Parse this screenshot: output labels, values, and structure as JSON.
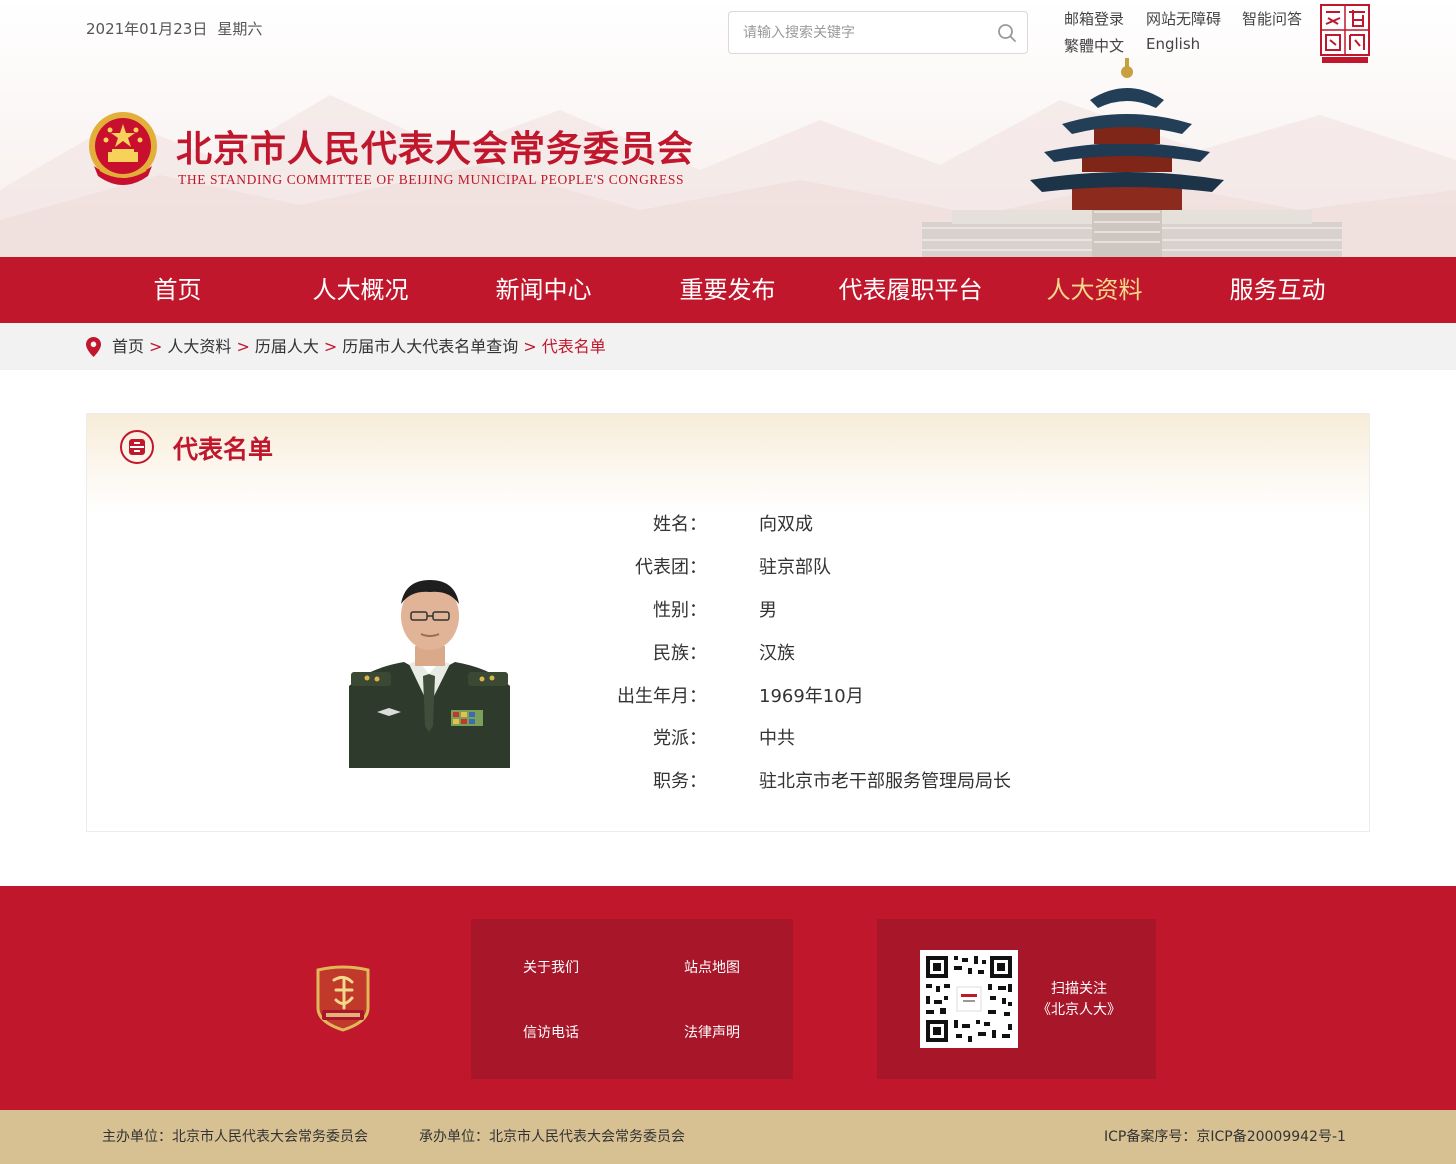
{
  "header": {
    "date": "2021年01月23日",
    "weekday": "星期六",
    "search_placeholder": "请输入搜索关键字",
    "links": {
      "mail_login": "邮箱登录",
      "accessibility": "网站无障碍",
      "smart_qa": "智能问答",
      "traditional": "繁體中文",
      "english": "English"
    },
    "site_title": "北京市人民代表大会常务委员会",
    "site_subtitle": "THE STANDING COMMITTEE OF BEIJING MUNICIPAL PEOPLE'S CONGRESS"
  },
  "nav": {
    "items": [
      "首页",
      "人大概况",
      "新闻中心",
      "重要发布",
      "代表履职平台",
      "人大资料",
      "服务互动"
    ],
    "active": "人大资料"
  },
  "breadcrumb": {
    "items": [
      "首页",
      "人大资料",
      "历届人大",
      "历届市人大代表名单查询"
    ],
    "current": "代表名单",
    "separator": ">"
  },
  "card": {
    "title": "代表名单",
    "fields": [
      {
        "label": "姓名：",
        "value": "向双成"
      },
      {
        "label": "代表团：",
        "value": "驻京部队"
      },
      {
        "label": "性别：",
        "value": "男"
      },
      {
        "label": "民族：",
        "value": "汉族"
      },
      {
        "label": "出生年月：",
        "value": "1969年10月"
      },
      {
        "label": "党派：",
        "value": "中共"
      },
      {
        "label": "职务：",
        "value": "驻北京市老干部服务管理局局长"
      }
    ]
  },
  "footer": {
    "links": [
      "关于我们",
      "站点地图",
      "信访电话",
      "法律声明"
    ],
    "qr_text_line1": "扫描关注",
    "qr_text_line2": "《北京人大》",
    "sponsor": "主办单位：北京市人民代表大会常务委员会",
    "organizer": "承办单位：北京市人民代表大会常务委员会",
    "icp": "ICP备案序号：京ICP备20009942号-1"
  },
  "colors": {
    "brand_red": "#c0172d",
    "footer_dark_red": "#a8162a",
    "active_nav_gold": "#f3d98c",
    "bottom_bar_tan": "#d7c193"
  },
  "icons": [
    "search-icon",
    "location-pin-icon",
    "list-card-icon"
  ]
}
